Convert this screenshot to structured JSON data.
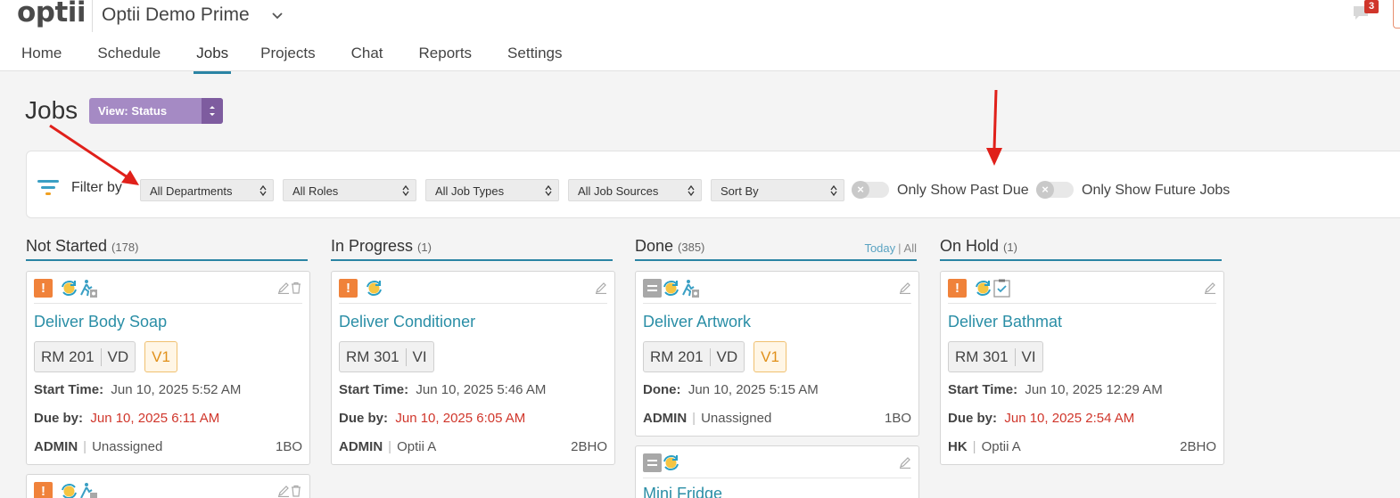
{
  "header": {
    "logo": "optii",
    "property_name": "Optii Demo Prime",
    "notification_count": "3",
    "nav": [
      {
        "label": "Home"
      },
      {
        "label": "Schedule"
      },
      {
        "label": "Jobs"
      },
      {
        "label": "Projects"
      },
      {
        "label": "Chat"
      },
      {
        "label": "Reports"
      },
      {
        "label": "Settings"
      }
    ]
  },
  "page": {
    "title": "Jobs",
    "view_select": "View: Status"
  },
  "filters": {
    "label": "Filter by",
    "departments": "All Departments",
    "roles": "All Roles",
    "job_types": "All Job Types",
    "job_sources": "All Job Sources",
    "sort_by": "Sort By",
    "past_due_label": "Only Show Past Due",
    "future_jobs_label": "Only Show Future Jobs"
  },
  "columns": [
    {
      "name": "Not Started",
      "count": "(178)",
      "cards": [
        {
          "title": "Deliver Body Soap",
          "room": "RM 201",
          "status": "VD",
          "v": "V1",
          "start_label": "Start Time:",
          "start": "Jun 10, 2025 5:52 AM",
          "due_label": "Due by:",
          "due": "Jun 10, 2025 6:11 AM",
          "dept": "ADMIN",
          "assignee": "Unassigned",
          "code": "1BO"
        }
      ]
    },
    {
      "name": "In Progress",
      "count": "(1)",
      "cards": [
        {
          "title": "Deliver Conditioner",
          "room": "RM 301",
          "status": "VI",
          "start_label": "Start Time:",
          "start": "Jun 10, 2025 5:46 AM",
          "due_label": "Due by:",
          "due": "Jun 10, 2025 6:05 AM",
          "dept": "ADMIN",
          "assignee": "Optii A",
          "code": "2BHO"
        }
      ]
    },
    {
      "name": "Done",
      "count": "(385)",
      "link_today": "Today",
      "link_sep": "|",
      "link_all": "All",
      "cards": [
        {
          "title": "Deliver Artwork",
          "room": "RM 201",
          "status": "VD",
          "v": "V1",
          "done_label": "Done:",
          "done": "Jun 10, 2025 5:15 AM",
          "dept": "ADMIN",
          "assignee": "Unassigned",
          "code": "1BO"
        },
        {
          "title": "Mini Fridge"
        }
      ]
    },
    {
      "name": "On Hold",
      "count": "(1)",
      "cards": [
        {
          "title": "Deliver Bathmat",
          "room": "RM 301",
          "status": "VI",
          "start_label": "Start Time:",
          "start": "Jun 10, 2025 12:29 AM",
          "due_label": "Due by:",
          "due": "Jun 10, 2025 2:54 AM",
          "dept": "HK",
          "assignee": "Optii A",
          "code": "2BHO"
        }
      ]
    }
  ],
  "colors": {
    "accent": "#2a84a4",
    "title_link": "#2a8ea6",
    "due_red": "#d0362b",
    "view_purple": "#a58ac4",
    "priority_orange": "#f0823a",
    "annotation_arrow": "#e0201a"
  },
  "icons": [
    "priority-high-icon",
    "priority-normal-icon",
    "recurring-icon",
    "runner-icon",
    "checklist-icon",
    "edit-icon",
    "trash-icon",
    "filter-icon",
    "chevron-down-icon",
    "chat-icon"
  ]
}
